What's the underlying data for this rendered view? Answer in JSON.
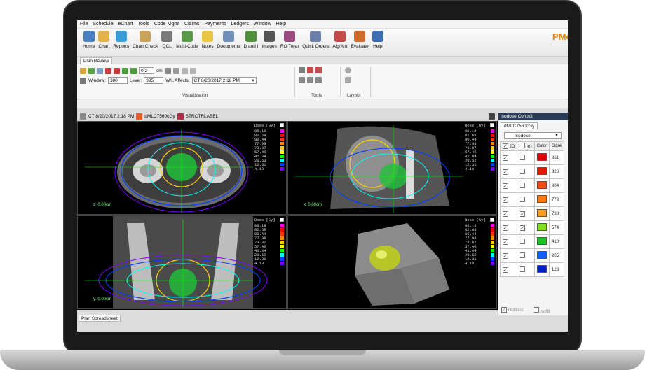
{
  "menu": [
    "File",
    "Schedule",
    "eChart",
    "Tools",
    "Code Mgmt",
    "Claims",
    "Payments",
    "Ledgers",
    "Window",
    "Help"
  ],
  "toolbar": [
    {
      "label": "Home",
      "icon": "home-icon",
      "color": "#4a7fc1"
    },
    {
      "label": "Chart",
      "icon": "folder-icon",
      "color": "#e2b34a"
    },
    {
      "label": "Reports",
      "icon": "report-icon",
      "color": "#3b9bd3"
    },
    {
      "label": "Chart Check",
      "icon": "chart-check-icon",
      "color": "#c9a35a"
    },
    {
      "label": "QCL",
      "icon": "qcl-list-icon",
      "color": "#7a7a7a"
    },
    {
      "label": "Multi-Code",
      "icon": "multi-code-icon",
      "color": "#5a9a4a"
    },
    {
      "label": "Notes",
      "icon": "notes-icon",
      "color": "#e8c542"
    },
    {
      "label": "Documents",
      "icon": "documents-icon",
      "color": "#6f8fb9"
    },
    {
      "label": "D and I",
      "icon": "d-and-i-icon",
      "color": "#4e8f3a"
    },
    {
      "label": "Images",
      "icon": "images-icon",
      "color": "#555555"
    },
    {
      "label": "RO Treat",
      "icon": "ro-treat-icon",
      "color": "#9a4a7f"
    },
    {
      "label": "Quick Orders",
      "icon": "quick-orders-icon",
      "color": "#6c7fa8"
    },
    {
      "label": "Alg/Alrt",
      "icon": "alert-icon",
      "color": "#c44b4b"
    },
    {
      "label": "Evaluate",
      "icon": "evaluate-icon",
      "color": "#d06a2a"
    },
    {
      "label": "Help",
      "icon": "help-icon",
      "color": "#3f6db5"
    }
  ],
  "brand_text": "PMo",
  "tab": "Plan Review",
  "ribbon": {
    "zoom_value": "0.2",
    "zoom_unit": "cm",
    "window_label": "Window:",
    "window_value": "380",
    "level_label": "Level:",
    "level_value": "995",
    "wl_label": "W/L Affects:",
    "wl_value": "CT 8/20/2017 2:18 PM",
    "groups": [
      "Visualization",
      "Tools",
      "Layout"
    ]
  },
  "viewer_bar": {
    "ct_label": "CT 8/20/2017 2:18 PM",
    "dose_label": "dMLC7560cGy",
    "struct_label": "STRCTRLABEL"
  },
  "legend": {
    "title": "Dose [Gy]",
    "levels": [
      {
        "value": "86.19",
        "color": "#ff00ff"
      },
      {
        "value": "82.68",
        "color": "#ff0000"
      },
      {
        "value": "80.44",
        "color": "#ff3b00"
      },
      {
        "value": "77.98",
        "color": "#ff8c00"
      },
      {
        "value": "73.87",
        "color": "#ffd000"
      },
      {
        "value": "57.46",
        "color": "#ffff00"
      },
      {
        "value": "41.04",
        "color": "#00ff00"
      },
      {
        "value": "20.52",
        "color": "#00ffff"
      },
      {
        "value": "12.31",
        "color": "#0040ff"
      },
      {
        "value": "4.10",
        "color": "#8000ff"
      }
    ]
  },
  "panes": [
    {
      "position_text": "z: 0.00cm"
    },
    {
      "position_text": "x: 0.00cm"
    },
    {
      "position_text": "y: 0.00cm"
    },
    {
      "position_text": ""
    }
  ],
  "bottom_tab": "Plan Spreadsheet",
  "isodose": {
    "title": "Isodose Control",
    "tab": "dMLC7560cGy",
    "dropdown": "Isodose",
    "headers": [
      "2D",
      "3D",
      "Color",
      "Dose"
    ],
    "rows": [
      {
        "d2": true,
        "d3": false,
        "color": "#e00000",
        "dose": "861"
      },
      {
        "d2": true,
        "d3": false,
        "color": "#e01a00",
        "dose": "820"
      },
      {
        "d2": true,
        "d3": false,
        "color": "#f04a10",
        "dose": "804"
      },
      {
        "d2": true,
        "d3": false,
        "color": "#ff7a10",
        "dose": "779"
      },
      {
        "d2": true,
        "d3": true,
        "color": "#ff9a30",
        "dose": "738"
      },
      {
        "d2": true,
        "d3": true,
        "color": "#80e020",
        "dose": "574"
      },
      {
        "d2": true,
        "d3": false,
        "color": "#20c020",
        "dose": "410"
      },
      {
        "d2": true,
        "d3": false,
        "color": "#1060ff",
        "dose": "205"
      },
      {
        "d2": true,
        "d3": false,
        "color": "#0020c0",
        "dose": "123"
      }
    ],
    "footer": [
      "Outlines",
      "Isofill"
    ]
  }
}
